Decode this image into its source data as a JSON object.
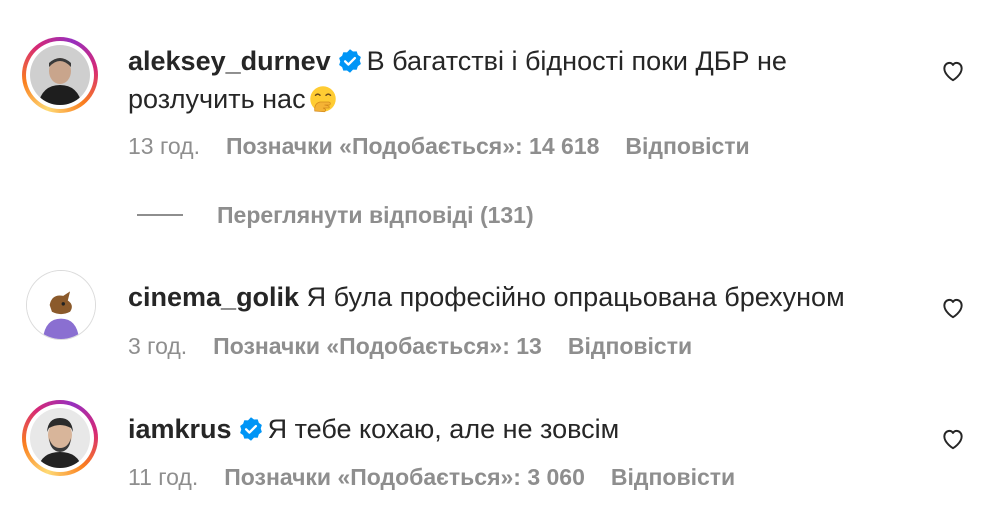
{
  "comments": [
    {
      "username": "aleksey_durnev",
      "verified": true,
      "text_line1": "В багатстві і бідності поки ДБР не",
      "text_line2": "розлучить нас",
      "emoji": "face-with-hand-over-mouth-emoji",
      "time": "13 год.",
      "likes": "Позначки «Подобається»: 14 618",
      "reply": "Відповісти"
    },
    {
      "username": "cinema_golik",
      "verified": false,
      "text_line1": "Я була професійно опрацьована брехуном",
      "avatar_text": "cinema_golik",
      "time": "3 год.",
      "likes": "Позначки «Подобається»: 13",
      "reply": "Відповісти"
    },
    {
      "username": "iamkrus",
      "verified": true,
      "text_line1": "Я тебе кохаю, але не зовсім",
      "time": "11 год.",
      "likes": "Позначки «Подобається»: 3 060",
      "reply": "Відповісти"
    }
  ],
  "view_replies": {
    "label": "Переглянути відповіді (131)"
  },
  "icons": {
    "like": "heart-outline-icon",
    "verified": "verified-badge-icon"
  },
  "colors": {
    "verified": "#0095f6",
    "secondary_text": "#8e8e8e",
    "primary_text": "#262626"
  }
}
